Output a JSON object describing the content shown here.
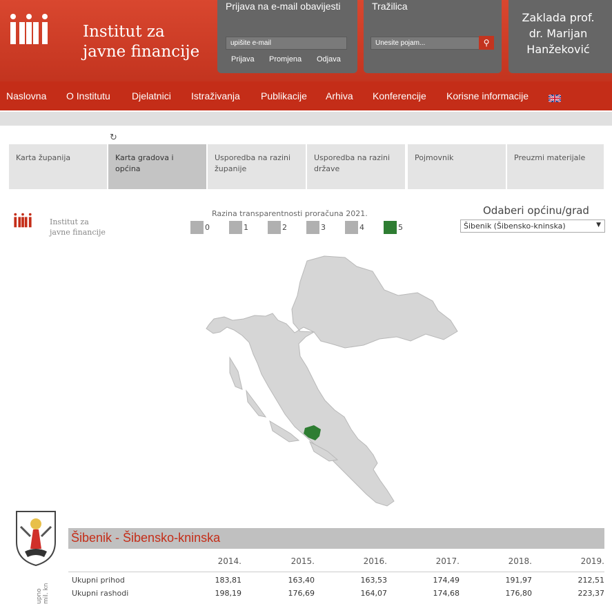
{
  "header": {
    "logo_line1": "Institut za",
    "logo_line2": "javne financije",
    "newsletter": {
      "title": "Prijava na e-mail obavijesti",
      "placeholder": "upišite e-mail",
      "links": [
        "Prijava",
        "Promjena",
        "Odjava"
      ]
    },
    "search": {
      "title": "Tražilica",
      "placeholder": "Unesite pojam..."
    },
    "zaklada": [
      "Zaklada prof.",
      "dr. Marijan",
      "Hanžeković"
    ]
  },
  "nav": [
    "Naslovna",
    "O Institutu",
    "Djelatnici",
    "Istraživanja",
    "Publikacije",
    "Arhiva",
    "Konferencije",
    "Korisne informacije"
  ],
  "tabs": [
    {
      "label": "Karta županija"
    },
    {
      "label": "Karta gradova i općina"
    },
    {
      "label": "Usporedba na razini županije"
    },
    {
      "label": "Usporedba na razini države"
    },
    {
      "label": "Pojmovnik"
    },
    {
      "label": "Preuzmi materijale"
    }
  ],
  "viz": {
    "logo_line1": "Institut za",
    "logo_line2": "javne financije",
    "legend_title": "Razina transparentnosti proračuna 2021.",
    "legend": [
      "0",
      "1",
      "2",
      "3",
      "4",
      "5"
    ],
    "dropdown_title": "Odaberi općinu/grad",
    "dropdown_value": "Šibenik (Šibensko-kninska)"
  },
  "colors": {
    "brand_red": "#c42d18",
    "level_5": "#2e7d32",
    "level_other": "#b0b0b0"
  },
  "table": {
    "city_title": "Šibenik - Šibensko-kninska",
    "years": [
      "2014.",
      "2015.",
      "2016.",
      "2017.",
      "2018.",
      "2019."
    ],
    "rows": [
      {
        "label": "Ukupni prihod",
        "values": [
          "183,81",
          "163,40",
          "163,53",
          "174,49",
          "191,97",
          "212,51"
        ]
      },
      {
        "label": "Ukupni rashodi",
        "values": [
          "198,19",
          "176,69",
          "164,07",
          "174,68",
          "176,80",
          "223,37"
        ]
      }
    ],
    "side_label": "upno mil. kn"
  }
}
